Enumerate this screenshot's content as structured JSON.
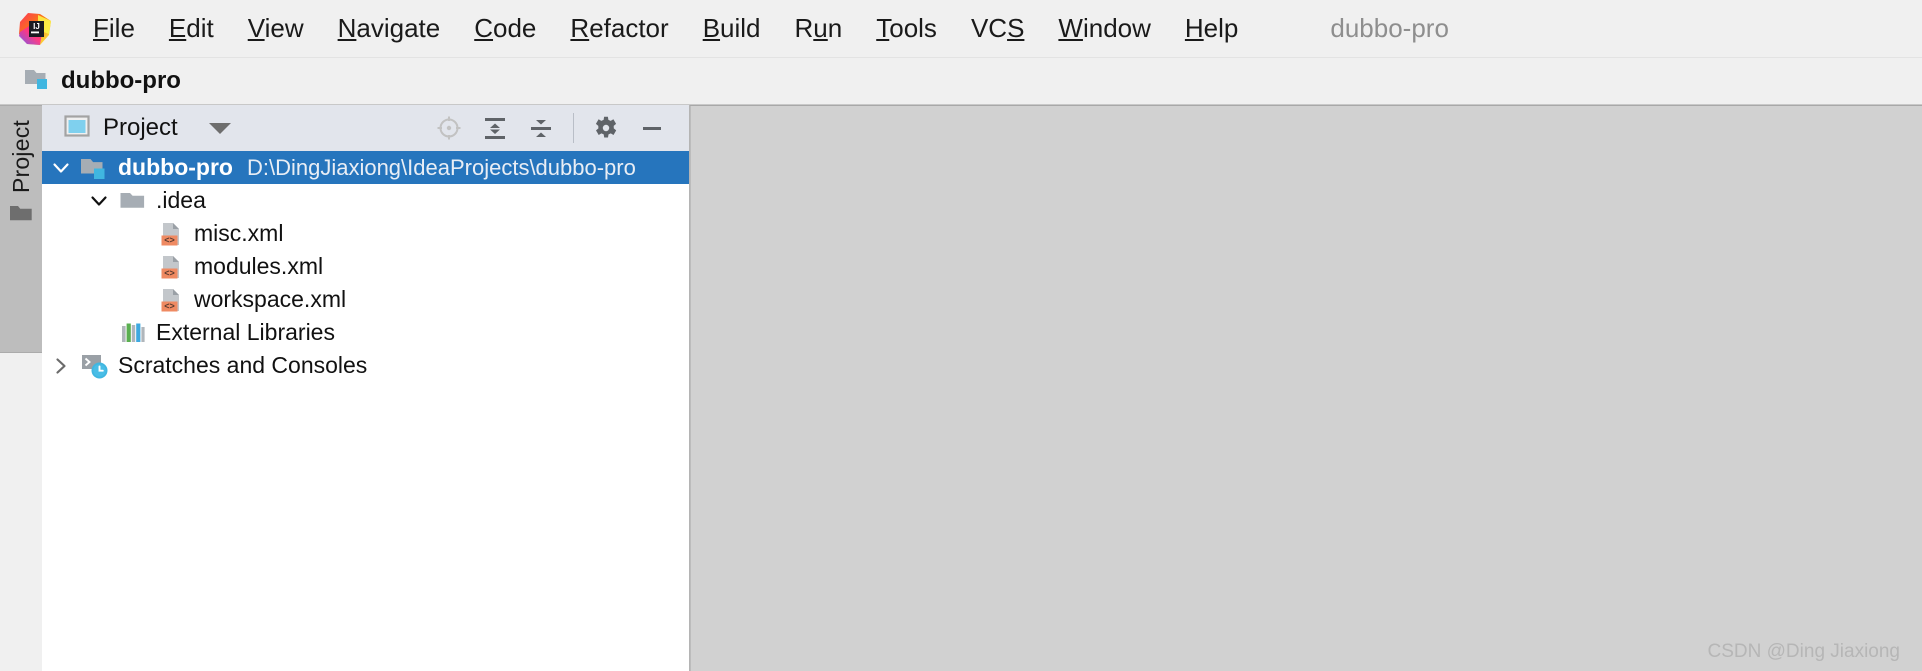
{
  "app": {
    "logo_icon": "intellij-idea-logo",
    "window_title": "dubbo-pro"
  },
  "menubar": {
    "items": [
      {
        "label": "File",
        "mnemonic": "F"
      },
      {
        "label": "Edit",
        "mnemonic": "E"
      },
      {
        "label": "View",
        "mnemonic": "V"
      },
      {
        "label": "Navigate",
        "mnemonic": "N"
      },
      {
        "label": "Code",
        "mnemonic": "C"
      },
      {
        "label": "Refactor",
        "mnemonic": "R"
      },
      {
        "label": "Build",
        "mnemonic": "B"
      },
      {
        "label": "Run",
        "mnemonic": "u"
      },
      {
        "label": "Tools",
        "mnemonic": "T"
      },
      {
        "label": "VCS",
        "mnemonic": "S"
      },
      {
        "label": "Window",
        "mnemonic": "W"
      },
      {
        "label": "Help",
        "mnemonic": "H"
      }
    ]
  },
  "navbar": {
    "crumb_icon": "project-folder-icon",
    "crumb_label": "dubbo-pro"
  },
  "stripe": {
    "project_tab_label": "Project",
    "project_tab_icon": "folder-icon"
  },
  "toolwindow": {
    "title": "Project",
    "title_icon": "project-view-icon",
    "view_selector_icon": "chevron-down-icon",
    "actions": [
      {
        "name": "select-opened-file-button",
        "icon": "crosshair-icon",
        "tooltip": "Select Opened File",
        "enabled": false
      },
      {
        "name": "expand-all-button",
        "icon": "expand-all-icon",
        "tooltip": "Expand All",
        "enabled": true
      },
      {
        "name": "collapse-all-button",
        "icon": "collapse-all-icon",
        "tooltip": "Collapse All",
        "enabled": true
      },
      {
        "name": "settings-button",
        "icon": "gear-icon",
        "tooltip": "Settings",
        "enabled": true
      },
      {
        "name": "hide-button",
        "icon": "minimize-icon",
        "tooltip": "Hide",
        "enabled": true
      }
    ]
  },
  "tree": {
    "rows": [
      {
        "label": "dubbo-pro",
        "path": "D:\\DingJiaxiong\\IdeaProjects\\dubbo-pro",
        "icon": "project-folder-icon",
        "indent": 0,
        "twisty": "expanded",
        "selected": true,
        "bold": true,
        "name": "tree-node-dubbo-pro"
      },
      {
        "label": ".idea",
        "path": "",
        "icon": "folder-icon",
        "indent": 1,
        "twisty": "expanded",
        "selected": false,
        "bold": false,
        "name": "tree-node-idea"
      },
      {
        "label": "misc.xml",
        "path": "",
        "icon": "xml-file-icon",
        "indent": 2,
        "twisty": "none",
        "selected": false,
        "bold": false,
        "name": "tree-node-misc-xml"
      },
      {
        "label": "modules.xml",
        "path": "",
        "icon": "xml-file-icon",
        "indent": 2,
        "twisty": "none",
        "selected": false,
        "bold": false,
        "name": "tree-node-modules-xml"
      },
      {
        "label": "workspace.xml",
        "path": "",
        "icon": "xml-file-icon",
        "indent": 2,
        "twisty": "none",
        "selected": false,
        "bold": false,
        "name": "tree-node-workspace-xml"
      },
      {
        "label": "External Libraries",
        "path": "",
        "icon": "library-icon",
        "indent": 1,
        "twisty": "none",
        "selected": false,
        "bold": false,
        "name": "tree-node-external-libraries"
      },
      {
        "label": "Scratches and Consoles",
        "path": "",
        "icon": "scratches-icon",
        "indent": 0,
        "twisty": "collapsed",
        "selected": false,
        "bold": false,
        "name": "tree-node-scratches-and-consoles"
      }
    ]
  },
  "editor": {
    "watermark": "CSDN @Ding Jiaxiong"
  },
  "colors": {
    "selection_blue": "#2675bd",
    "toolbar_bg": "#e2e5ec",
    "editor_bg": "#d1d1d1",
    "chrome_bg": "#f0f0f0",
    "xml_badge_orange": "#ef8a62",
    "folder_gray": "#a6adb4",
    "accent_cyan": "#40b6e0"
  }
}
